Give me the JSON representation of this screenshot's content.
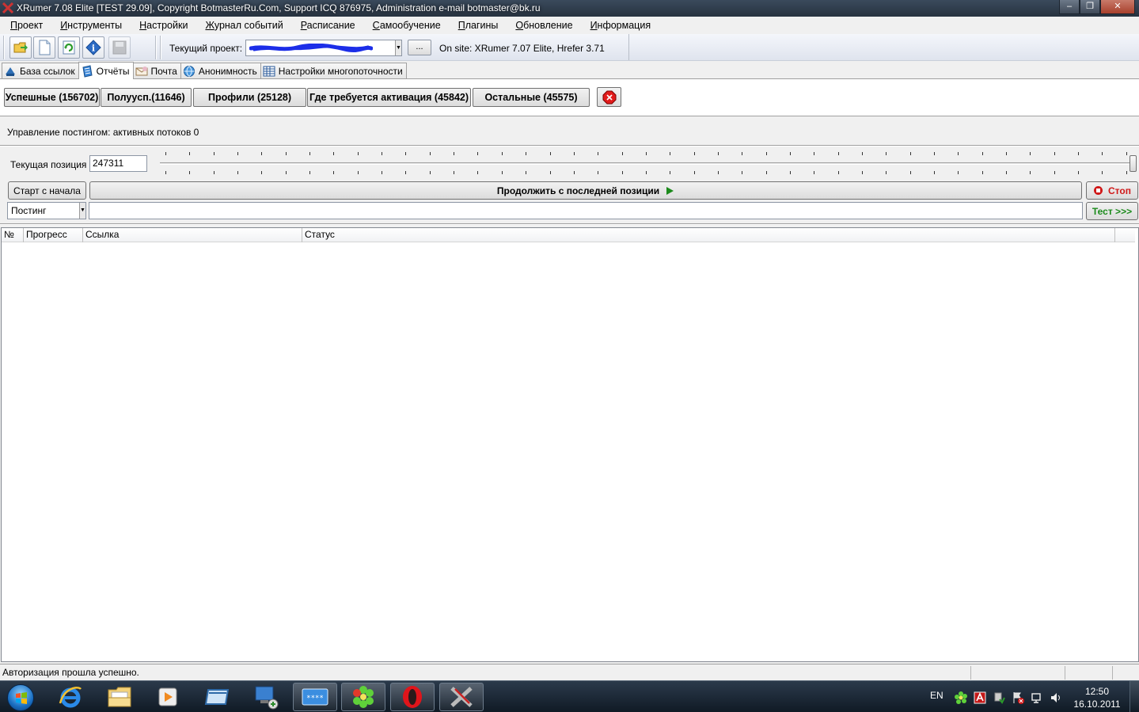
{
  "window": {
    "title": "XRumer 7.08 Elite [TEST 29.09], Copyright BotmasterRu.Com, Support ICQ 876975, Administration e-mail botmaster@bk.ru",
    "minimize": "‒",
    "maximize": "❐",
    "close": "✕"
  },
  "menu": [
    "Проект",
    "Инструменты",
    "Настройки",
    "Журнал событий",
    "Расписание",
    "Самообучение",
    "Плагины",
    "Обновление",
    "Информация"
  ],
  "toolbar": {
    "project_label": "Текущий проект:",
    "browse_label": "...",
    "site_info": "On site: XRumer 7.07 Elite, Hrefer 3.71"
  },
  "tabs": [
    {
      "label": "База ссылок",
      "icon": "database-icon",
      "active": false
    },
    {
      "label": "Отчёты",
      "icon": "reports-icon",
      "active": true
    },
    {
      "label": "Почта",
      "icon": "mail-icon",
      "active": false
    },
    {
      "label": "Анонимность",
      "icon": "globe-icon",
      "active": false
    },
    {
      "label": "Настройки многопоточности",
      "icon": "threads-icon",
      "active": false
    }
  ],
  "reports": {
    "successful": "Успешные (156702)",
    "semi": "Полууcп.(11646)",
    "profiles": "Профили (25128)",
    "activation": "Где требуется активация (45842)",
    "other": "Остальные (45575)"
  },
  "posting": {
    "status": "Управление постингом: активных потоков 0",
    "position_label": "Текущая позиция",
    "position_value": "247311",
    "slider_level": 1.0,
    "start_over": "Старт с начала",
    "continue": "Продолжить с последней позиции",
    "stop": "Стоп",
    "mode": "Постинг",
    "test": "Тест >>>"
  },
  "table": {
    "columns": [
      "№",
      "Прогресс",
      "Ссылка",
      "Статус"
    ],
    "rows": []
  },
  "statusbar": {
    "message": "Авторизация прошла успешно."
  },
  "taskbar": {
    "language": "EN",
    "time": "12:50",
    "date": "16.10.2011"
  },
  "colors": {
    "accent_green": "#1b8a1b",
    "stop_red": "#d01818",
    "titlebar": "#2f3c4b"
  }
}
